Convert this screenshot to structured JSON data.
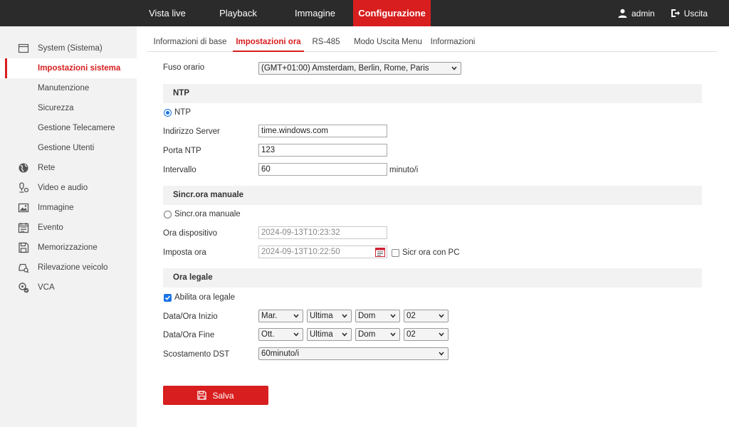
{
  "topnav": {
    "items": [
      {
        "label": "Vista live",
        "active": false
      },
      {
        "label": "Playback",
        "active": false
      },
      {
        "label": "Immagine",
        "active": false
      },
      {
        "label": "Configurazione",
        "active": true
      }
    ],
    "user": "admin",
    "logout": "Uscita"
  },
  "sidebar": {
    "items": [
      {
        "label": "System (Sistema)",
        "icon": "system-icon"
      },
      {
        "label": "Impostazioni sistema",
        "active": true
      },
      {
        "label": "Manutenzione"
      },
      {
        "label": "Sicurezza"
      },
      {
        "label": "Gestione Telecamere"
      },
      {
        "label": "Gestione Utenti"
      },
      {
        "label": "Rete",
        "icon": "globe-icon"
      },
      {
        "label": "Video e audio",
        "icon": "microphone-icon"
      },
      {
        "label": "Immagine",
        "icon": "image-icon"
      },
      {
        "label": "Evento",
        "icon": "calendar-icon"
      },
      {
        "label": "Memorizzazione",
        "icon": "storage-icon"
      },
      {
        "label": "Rilevazione veicolo",
        "icon": "vehicle-detection-icon"
      },
      {
        "label": "VCA",
        "icon": "vca-icon"
      }
    ]
  },
  "tabs": [
    {
      "label": "Informazioni di base"
    },
    {
      "label": "Impostazioni ora",
      "active": true
    },
    {
      "label": "RS-485"
    },
    {
      "label": "Modo Uscita Menu"
    },
    {
      "label": "Informazioni"
    }
  ],
  "form": {
    "timezone_label": "Fuso orario",
    "timezone_value": "(GMT+01:00) Amsterdam, Berlin, Rome, Paris",
    "ntp_section": "NTP",
    "ntp_radio_label": "NTP",
    "server_label": "Indirizzo Server",
    "server_value": "time.windows.com",
    "port_label": "Porta NTP",
    "port_value": "123",
    "interval_label": "Intervallo",
    "interval_value": "60",
    "interval_unit": "minuto/i",
    "manual_section": "Sincr.ora manuale",
    "manual_radio_label": "Sincr.ora manuale",
    "device_time_label": "Ora dispositivo",
    "device_time_value": "2024-09-13T10:23:32",
    "set_time_label": "Imposta ora",
    "set_time_value": "2024-09-13T10:22:50",
    "sync_pc_label": "Sicr ora con PC",
    "dst_section": "Ora legale",
    "dst_enable_label": "Abilita ora legale",
    "start_label": "Data/Ora Inizio",
    "start_month": "Mar.",
    "start_week": "Ultima",
    "start_day": "Dom",
    "start_hour": "02",
    "end_label": "Data/Ora Fine",
    "end_month": "Ott.",
    "end_week": "Ultima",
    "end_day": "Dom",
    "end_hour": "02",
    "offset_label": "Scostamento DST",
    "offset_value": "60minuto/i",
    "save_label": "Salva"
  },
  "colors": {
    "accent": "#d81e1e",
    "topbar": "#2b2b2b",
    "sidebar": "#f2f2f2",
    "check": "#1a73e8"
  }
}
